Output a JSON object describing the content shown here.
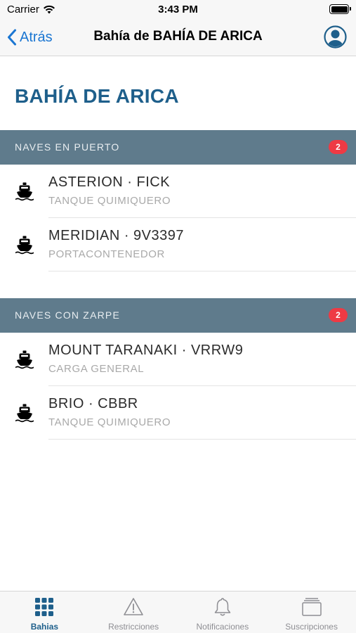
{
  "status_bar": {
    "carrier": "Carrier",
    "time": "3:43 PM"
  },
  "nav": {
    "back_label": "Atrás",
    "title": "Bahía de BAHÍA DE ARICA",
    "profile_icon": "user-circle-icon"
  },
  "page": {
    "title": "BAHÍA DE ARICA"
  },
  "sections": [
    {
      "label": "NAVES EN PUERTO",
      "count": "2",
      "items": [
        {
          "name": "ASTERION · FICK",
          "type": "TANQUE QUIMIQUERO"
        },
        {
          "name": "MERIDIAN · 9V3397",
          "type": "PORTACONTENEDOR"
        }
      ]
    },
    {
      "label": "NAVES CON ZARPE",
      "count": "2",
      "items": [
        {
          "name": "MOUNT TARANAKI · VRRW9",
          "type": "CARGA GENERAL"
        },
        {
          "name": "BRIO · CBBR",
          "type": "TANQUE QUIMIQUERO"
        }
      ]
    }
  ],
  "tabs": [
    {
      "label": "Bahias",
      "icon": "grid-icon",
      "active": true
    },
    {
      "label": "Restricciones",
      "icon": "warning-icon",
      "active": false
    },
    {
      "label": "Notificaciones",
      "icon": "bell-icon",
      "active": false
    },
    {
      "label": "Suscripciones",
      "icon": "cards-icon",
      "active": false
    }
  ],
  "colors": {
    "accent": "#1e5f8b",
    "link": "#1b76d2",
    "section_header": "#5f7b8c",
    "badge": "#ee3a44"
  }
}
